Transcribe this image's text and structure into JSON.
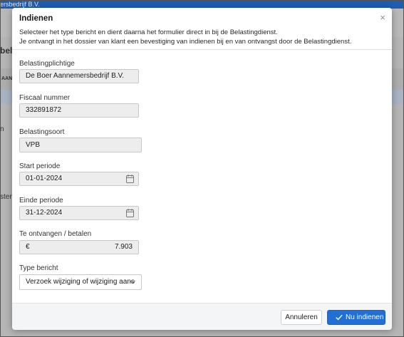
{
  "background": {
    "topbar_text": "ersbedrijf B.V.",
    "left_heading": "belc",
    "col_header": "AAN",
    "row1_text": "n",
    "row2_text": "sten"
  },
  "modal": {
    "title": "Indienen",
    "close_glyph": "×",
    "intro_line1": "Selecteer het type bericht en dient daarna het formulier direct in bij de Belastingdienst.",
    "intro_line2": "Je ontvangt in het dossier van klant een bevestiging van indienen bij en van ontvangst door de Belastingdienst."
  },
  "form": {
    "belastingplichtige_label": "Belastingplichtige",
    "belastingplichtige_value": "De Boer Aannemersbedrijf B.V.",
    "fiscaal_label": "Fiscaal nummer",
    "fiscaal_value": "332891872",
    "soort_label": "Belastingsoort",
    "soort_value": "VPB",
    "start_label": "Start periode",
    "start_value": "01-01-2024",
    "einde_label": "Einde periode",
    "einde_value": "31-12-2024",
    "bedrag_label": "Te ontvangen / betalen",
    "bedrag_currency": "€",
    "bedrag_value": "7.903",
    "type_label": "Type bericht",
    "type_value": "Verzoek wijziging of wijziging aans"
  },
  "footer": {
    "cancel_label": "Annuleren",
    "submit_label": "Nu indienen"
  },
  "colors": {
    "primary": "#1f6fd6",
    "topbar": "#1f5db2"
  }
}
